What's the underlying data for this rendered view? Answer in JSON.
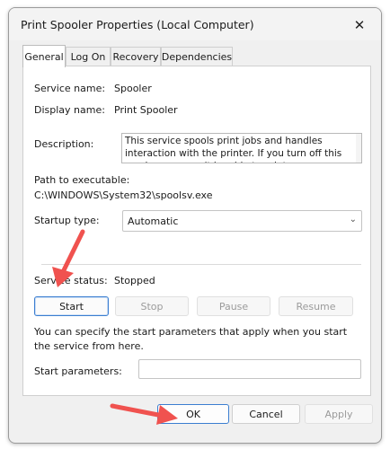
{
  "window": {
    "title": "Print Spooler Properties (Local Computer)",
    "close_symbol": "✕"
  },
  "tabs": [
    {
      "label": "General",
      "active": true
    },
    {
      "label": "Log On",
      "active": false
    },
    {
      "label": "Recovery",
      "active": false
    },
    {
      "label": "Dependencies",
      "active": false
    }
  ],
  "general": {
    "service_name_label": "Service name:",
    "service_name": "Spooler",
    "display_name_label": "Display name:",
    "display_name": "Print Spooler",
    "description_label": "Description:",
    "description": "This service spools print jobs and handles interaction with the printer.  If you turn off this service, you won't be able to print or see your printers.",
    "path_label": "Path to executable:",
    "path": "C:\\WINDOWS\\System32\\spoolsv.exe",
    "startup_type_label": "Startup type:",
    "startup_type": "Automatic",
    "service_status_label": "Service status:",
    "service_status": "Stopped",
    "start_label": "Start",
    "stop_label": "Stop",
    "pause_label": "Pause",
    "resume_label": "Resume",
    "note": "You can specify the start parameters that apply when you start the service from here.",
    "start_params_label": "Start parameters:",
    "start_params_value": ""
  },
  "footer": {
    "ok_label": "OK",
    "cancel_label": "Cancel",
    "apply_label": "Apply"
  },
  "colors": {
    "annotation_arrow": "#f0524f",
    "focus_border": "#3b7ed0"
  },
  "icons": {
    "close": "close-icon",
    "dropdown": "chevron-down-icon",
    "annotation": "red-arrow-icon"
  }
}
